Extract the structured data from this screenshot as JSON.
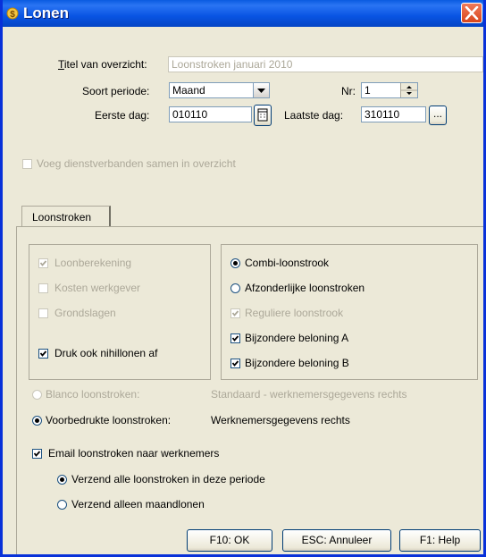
{
  "window": {
    "title": "Lonen"
  },
  "form": {
    "titel_label": "Titel van overzicht:",
    "titel_value": "Loonstroken januari 2010",
    "soort_label": "Soort periode:",
    "soort_value": "Maand",
    "nr_label": "Nr:",
    "nr_value": "1",
    "eerste_label": "Eerste dag:",
    "eerste_value": "010110",
    "laatste_label": "Laatste dag:",
    "laatste_value": "310110",
    "ellipsis": "...",
    "voeg_label": "Voeg dienstverbanden samen in overzicht"
  },
  "tabs": [
    {
      "label": "Loonstroken"
    }
  ],
  "left_group": {
    "loonberekening": "Loonberekening",
    "kosten": "Kosten werkgever",
    "grondslagen": "Grondslagen",
    "druk": "Druk ook nihillonen af"
  },
  "right_group": {
    "combi": "Combi-loonstrook",
    "afzonderlijke": "Afzonderlijke loonstroken",
    "reguliere": "Reguliere loonstrook",
    "bijzondere_a": "Bijzondere beloning A",
    "bijzondere_b": "Bijzondere beloning B"
  },
  "options": {
    "blanco_label": "Blanco loonstroken:",
    "blanco_value": "Standaard - werknemersgegevens rechts",
    "voorbedrukt_label": "Voorbedrukte loonstroken:",
    "voorbedrukt_value": "Werknemersgegevens rechts",
    "email_label": "Email loonstroken naar werknemers",
    "verzend_alle": "Verzend alle loonstroken in deze periode",
    "verzend_alleen": "Verzend alleen maandlonen"
  },
  "buttons": {
    "ok": "F10: OK",
    "annuleer": "ESC: Annuleer",
    "help": "F1: Help"
  }
}
